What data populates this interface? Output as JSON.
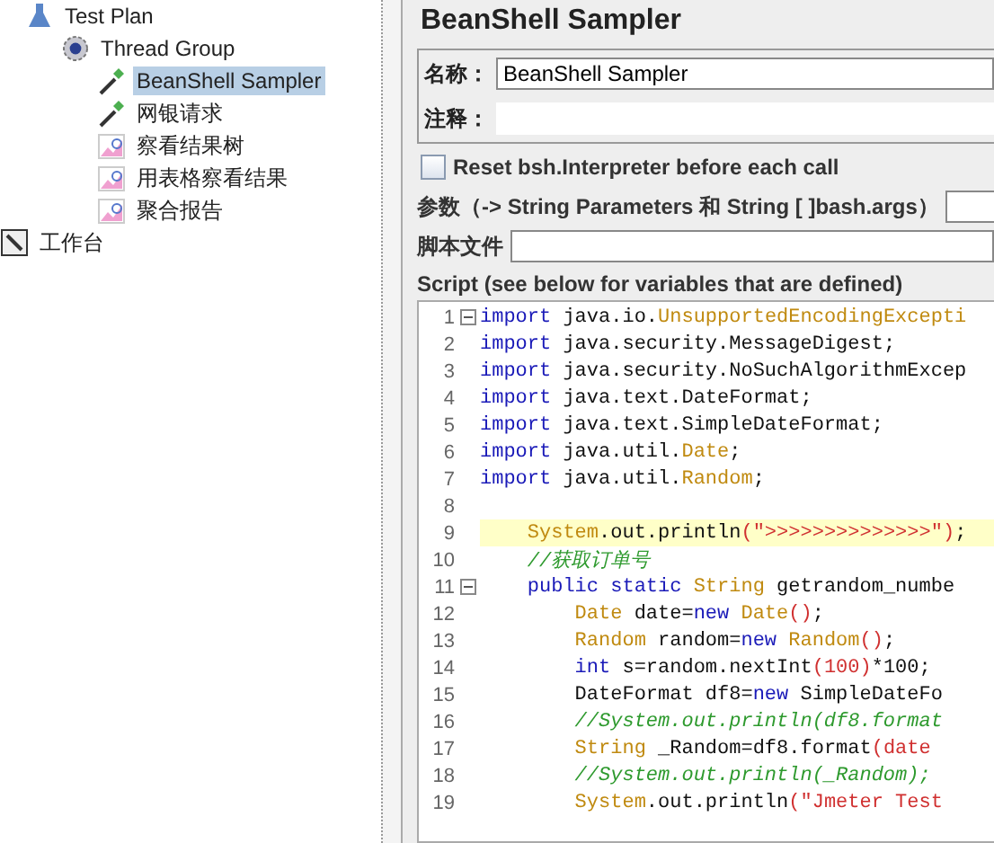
{
  "tree": [
    {
      "label": "Test Plan",
      "kind": "plan",
      "selected": false,
      "children": [
        {
          "label": "Thread Group",
          "kind": "threads",
          "selected": false,
          "children": [
            {
              "label": "BeanShell Sampler",
              "kind": "sampler",
              "selected": true
            },
            {
              "label": "网银请求",
              "kind": "sampler",
              "selected": false
            },
            {
              "label": "察看结果树",
              "kind": "listener",
              "selected": false
            },
            {
              "label": "用表格察看结果",
              "kind": "listener",
              "selected": false
            },
            {
              "label": "聚合报告",
              "kind": "listener",
              "selected": false
            }
          ]
        }
      ]
    },
    {
      "label": "工作台",
      "kind": "workbench",
      "selected": false
    }
  ],
  "panel": {
    "title": "BeanShell Sampler",
    "name": {
      "label": "名称：",
      "value": "BeanShell Sampler"
    },
    "comment": {
      "label": "注释："
    },
    "reset": {
      "label": "Reset bsh.Interpreter before each call",
      "checked": false
    },
    "params": {
      "label": "参数（-> String Parameters 和 String [ ]bash.args）"
    },
    "file": {
      "label": "脚本文件"
    },
    "script_label": "Script (see below for variables that are defined)",
    "code": [
      {
        "n": "1",
        "fold": true,
        "highlight": false,
        "tokens": [
          {
            "kind": "kw",
            "t": "import"
          },
          {
            "kind": "plain",
            "t": " java.io."
          },
          {
            "kind": "type",
            "t": "UnsupportedEncodingExcepti"
          }
        ]
      },
      {
        "n": "2",
        "fold": false,
        "highlight": false,
        "tokens": [
          {
            "kind": "kw",
            "t": "import"
          },
          {
            "kind": "plain",
            "t": " java.security.MessageDigest;"
          }
        ]
      },
      {
        "n": "3",
        "fold": false,
        "highlight": false,
        "tokens": [
          {
            "kind": "kw",
            "t": "import"
          },
          {
            "kind": "plain",
            "t": " java.security.NoSuchAlgorithmExcep"
          }
        ]
      },
      {
        "n": "4",
        "fold": false,
        "highlight": false,
        "tokens": [
          {
            "kind": "kw",
            "t": "import"
          },
          {
            "kind": "plain",
            "t": " java.text.DateFormat;"
          }
        ]
      },
      {
        "n": "5",
        "fold": false,
        "highlight": false,
        "tokens": [
          {
            "kind": "kw",
            "t": "import"
          },
          {
            "kind": "plain",
            "t": " java.text.SimpleDateFormat;"
          }
        ]
      },
      {
        "n": "6",
        "fold": false,
        "highlight": false,
        "tokens": [
          {
            "kind": "kw",
            "t": "import"
          },
          {
            "kind": "plain",
            "t": " java.util."
          },
          {
            "kind": "type",
            "t": "Date"
          },
          {
            "kind": "plain",
            "t": ";"
          }
        ]
      },
      {
        "n": "7",
        "fold": false,
        "highlight": false,
        "tokens": [
          {
            "kind": "kw",
            "t": "import"
          },
          {
            "kind": "plain",
            "t": " java.util."
          },
          {
            "kind": "type",
            "t": "Random"
          },
          {
            "kind": "plain",
            "t": ";"
          }
        ]
      },
      {
        "n": "8",
        "fold": false,
        "highlight": false
      },
      {
        "n": "9",
        "fold": false,
        "highlight": true,
        "tokens": [
          {
            "kind": "type",
            "t": "    System"
          },
          {
            "kind": "plain",
            "t": ".out.println"
          },
          {
            "kind": "str",
            "t": "(\">>>>>>>>>>>>>>\")"
          },
          {
            "kind": "plain",
            "t": ";"
          }
        ]
      },
      {
        "n": "10",
        "fold": false,
        "highlight": false,
        "tokens": [
          {
            "kind": "cm",
            "t": "    //获取订单号"
          }
        ]
      },
      {
        "n": "11",
        "fold": true,
        "highlight": false,
        "tokens": [
          {
            "kind": "kw",
            "t": "    public static "
          },
          {
            "kind": "type",
            "t": "String"
          },
          {
            "kind": "plain",
            "t": " getrandom_numbe"
          }
        ]
      },
      {
        "n": "12",
        "fold": false,
        "highlight": false,
        "tokens": [
          {
            "kind": "type",
            "t": "        Date"
          },
          {
            "kind": "plain",
            "t": " date="
          },
          {
            "kind": "kw",
            "t": "new "
          },
          {
            "kind": "type",
            "t": "Date"
          },
          {
            "kind": "str",
            "t": "()"
          },
          {
            "kind": "plain",
            "t": ";"
          }
        ]
      },
      {
        "n": "13",
        "fold": false,
        "highlight": false,
        "tokens": [
          {
            "kind": "type",
            "t": "        Random"
          },
          {
            "kind": "plain",
            "t": " random="
          },
          {
            "kind": "kw",
            "t": "new "
          },
          {
            "kind": "type",
            "t": "Random"
          },
          {
            "kind": "str",
            "t": "()"
          },
          {
            "kind": "plain",
            "t": ";"
          }
        ]
      },
      {
        "n": "14",
        "fold": false,
        "highlight": false,
        "tokens": [
          {
            "kind": "kw",
            "t": "        int"
          },
          {
            "kind": "plain",
            "t": " s=random.nextInt"
          },
          {
            "kind": "str",
            "t": "(100)"
          },
          {
            "kind": "plain",
            "t": "*100;"
          }
        ]
      },
      {
        "n": "15",
        "fold": false,
        "highlight": false,
        "tokens": [
          {
            "kind": "plain",
            "t": "        DateFormat df8="
          },
          {
            "kind": "kw",
            "t": "new"
          },
          {
            "kind": "plain",
            "t": " SimpleDateFo"
          }
        ]
      },
      {
        "n": "16",
        "fold": false,
        "highlight": false,
        "tokens": [
          {
            "kind": "cm",
            "t": "        //System.out.println(df8.format"
          }
        ]
      },
      {
        "n": "17",
        "fold": false,
        "highlight": false,
        "tokens": [
          {
            "kind": "type",
            "t": "        String"
          },
          {
            "kind": "plain",
            "t": " _Random=df8.format"
          },
          {
            "kind": "str",
            "t": "(date"
          }
        ]
      },
      {
        "n": "18",
        "fold": false,
        "highlight": false,
        "tokens": [
          {
            "kind": "cm",
            "t": "        //System.out.println(_Random);"
          }
        ]
      },
      {
        "n": "19",
        "fold": false,
        "highlight": false,
        "tokens": [
          {
            "kind": "type",
            "t": "        System"
          },
          {
            "kind": "plain",
            "t": ".out.println"
          },
          {
            "kind": "str",
            "t": "(\"Jmeter Test"
          }
        ]
      }
    ]
  }
}
